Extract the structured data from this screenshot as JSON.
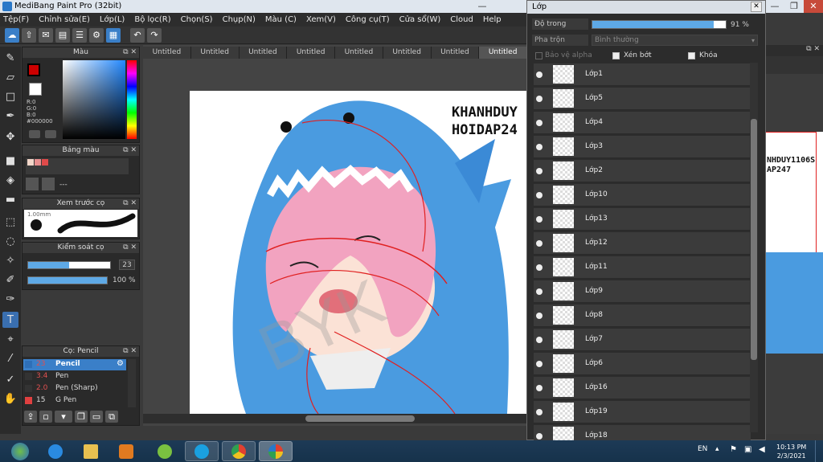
{
  "window": {
    "title": "MediBang Paint Pro (32bit)",
    "controls": {
      "minimize": "—",
      "maximize": "❐",
      "close": "✕"
    }
  },
  "menu": [
    "Tệp(F)",
    "Chỉnh sửa(E)",
    "Lớp(L)",
    "Bộ lọc(R)",
    "Chọn(S)",
    "Chụp(N)",
    "Màu (C)",
    "Xem(V)",
    "Công cụ(T)",
    "Cửa sổ(W)",
    "Cloud",
    "Help"
  ],
  "tabs": [
    "Untitled",
    "Untitled",
    "Untitled",
    "Untitled",
    "Untitled",
    "Untitled",
    "Untitled",
    "Untitled"
  ],
  "color_panel": {
    "title": "Màu",
    "r": "R:0",
    "g": "G:0",
    "b": "B:0",
    "hex": "#000000",
    "primary": "#cc0000",
    "secondary": "#ffffff"
  },
  "palette_panel": {
    "title": "Bảng màu",
    "swatches": [
      "#f2d6c9",
      "#e88f8f",
      "#e04a4a"
    ],
    "label": "---"
  },
  "brush_preview": {
    "title": "Xem trước cọ",
    "size": "1.00mm"
  },
  "brush_control": {
    "title": "Kiểm soát cọ",
    "size_value": "23",
    "opacity_value": "100 %",
    "size_fraction": 0.5,
    "opacity_fraction": 1.0
  },
  "brush_list": {
    "title": "Cọ: Pencil",
    "items": [
      {
        "size": "23",
        "name": "Pencil",
        "color": "#2e6fb8",
        "selected": true
      },
      {
        "size": "3.4",
        "name": "Pen",
        "color": "#333333",
        "selected": false
      },
      {
        "size": "2.0",
        "name": "Pen (Sharp)",
        "color": "#333333",
        "selected": false
      },
      {
        "size": "15",
        "name": "G Pen",
        "color": "#e04040",
        "selected": false
      }
    ]
  },
  "canvas_text": {
    "line1": "KHANHDUY",
    "line2": "HOIDAP24"
  },
  "right_canvas_text": {
    "line1": "NHDUY1106S",
    "line2": "AP247"
  },
  "layers_window": {
    "title": "Lớp",
    "opacity_label": "Độ trong",
    "opacity_value": "91 %",
    "opacity_fraction": 0.91,
    "blend_label": "Pha trộn",
    "blend_value": "Bình thường",
    "protect_alpha": "Bảo vệ alpha",
    "clipping": "Xén bớt",
    "lock": "Khóa",
    "layers": [
      "Lớp1",
      "Lớp5",
      "Lớp4",
      "Lớp3",
      "Lớp2",
      "Lớp10",
      "Lớp13",
      "Lớp12",
      "Lớp11",
      "Lớp9",
      "Lớp8",
      "Lớp7",
      "Lớp6",
      "Lớp16",
      "Lớp19",
      "Lớp18"
    ]
  },
  "taskbar": {
    "language": "EN",
    "time": "10:13 PM",
    "date": "2/3/2021",
    "apps": [
      "start-orb",
      "internet-explorer",
      "file-explorer",
      "media-player",
      "recorder",
      "skype",
      "chrome",
      "medibang"
    ]
  },
  "colors": {
    "accent": "#3a7fc8",
    "progress": "#5ea9e6",
    "hood_blue": "#4a9be0",
    "hair_pink": "#f2a3c0"
  }
}
